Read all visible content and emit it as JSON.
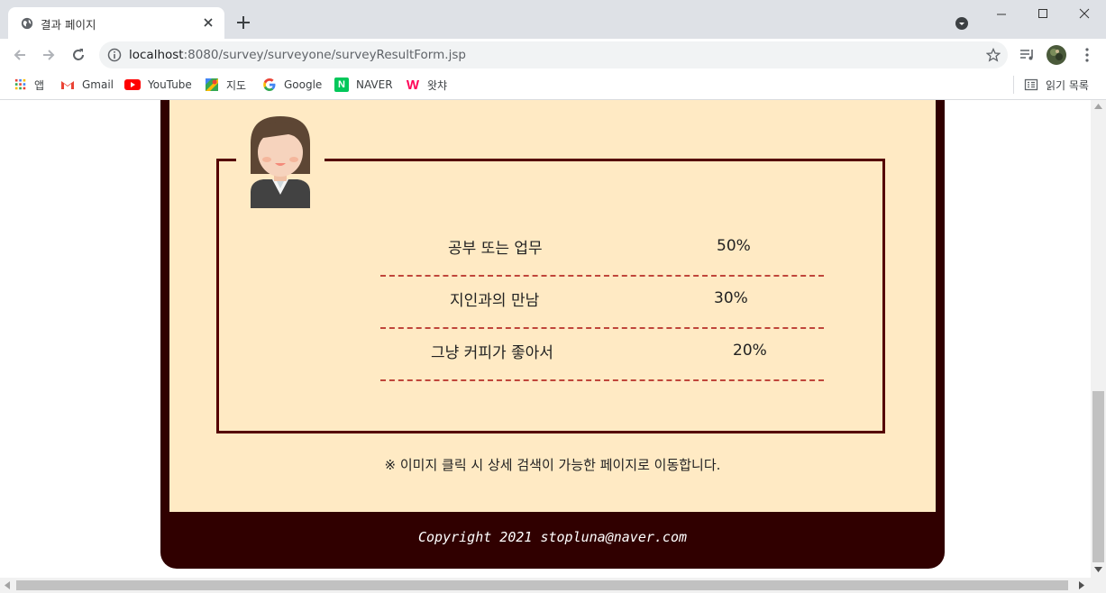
{
  "browser": {
    "tab_title": "결과 페이지",
    "url_host": "localhost",
    "url_rest": ":8080/survey/surveyone/surveyResultForm.jsp",
    "bookmarks": [
      {
        "label": "앱",
        "icon": "apps-grid-icon"
      },
      {
        "label": "Gmail",
        "icon": "gmail-icon"
      },
      {
        "label": "YouTube",
        "icon": "youtube-icon"
      },
      {
        "label": "지도",
        "icon": "maps-icon"
      },
      {
        "label": "Google",
        "icon": "google-icon"
      },
      {
        "label": "NAVER",
        "icon": "naver-icon"
      },
      {
        "label": "왓챠",
        "icon": "watcha-icon"
      }
    ],
    "reading_list": "읽기 목록"
  },
  "results": {
    "rows": [
      {
        "label": "공부 또는 업무",
        "percent": "50%"
      },
      {
        "label": "지인과의 만남",
        "percent": "30%"
      },
      {
        "label": "그냥 커피가 좋아서",
        "percent": "20%"
      }
    ],
    "note": "※ 이미지 클릭 시 상세 검색이 가능한 페이지로 이동합니다."
  },
  "footer": {
    "copyright": "Copyright 2021 stopluna@naver.com"
  },
  "colors": {
    "background_dark": "#300000",
    "panel": "#ffeac4",
    "frame_border": "#550000",
    "divider": "#c0463b"
  }
}
